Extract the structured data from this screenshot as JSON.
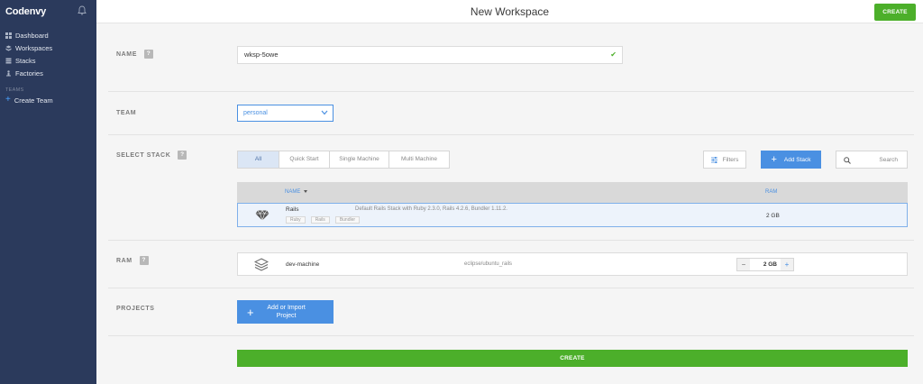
{
  "app": {
    "logo": "Codenvy"
  },
  "sidebar": {
    "items": [
      {
        "label": "Dashboard",
        "icon": "dashboard-icon"
      },
      {
        "label": "Workspaces",
        "icon": "workspaces-icon"
      },
      {
        "label": "Stacks",
        "icon": "stacks-icon"
      },
      {
        "label": "Factories",
        "icon": "factories-icon"
      }
    ],
    "teams_title": "TEAMS",
    "create_team": "Create Team"
  },
  "header": {
    "title": "New Workspace",
    "create_label": "CREATE"
  },
  "name_section": {
    "label": "NAME",
    "help": "?",
    "value": "wksp-5owe",
    "valid_icon": "✔"
  },
  "team_section": {
    "label": "TEAM",
    "selected": "personal"
  },
  "stack_section": {
    "label": "SELECT STACK",
    "help": "?",
    "tabs": [
      "All",
      "Quick Start",
      "Single Machine",
      "Multi Machine"
    ],
    "active_tab": "All",
    "filters_label": "Filters",
    "add_stack_label": "Add Stack",
    "search_placeholder": "Search",
    "table": {
      "columns": [
        "NAME",
        "RAM"
      ],
      "rows": [
        {
          "name": "Rails",
          "description": "Default Rails Stack with Ruby 2.3.0, Rails 4.2.6, Bundler 1.11.2.",
          "tags": [
            "Ruby",
            "Rails",
            "Bundler"
          ],
          "ram": "2 GB",
          "selected": true
        }
      ]
    }
  },
  "ram_section": {
    "label": "RAM",
    "help": "?",
    "machine": {
      "name": "dev-machine",
      "image": "eclipse/ubuntu_rails",
      "ram": "2 GB",
      "minus": "−",
      "plus": "+"
    }
  },
  "projects_section": {
    "label": "PROJECTS",
    "add_label": "Add or Import Project"
  },
  "footer": {
    "create_label": "CREATE"
  },
  "colors": {
    "sidebar": "#2b3a5c",
    "accent": "#4a90e2",
    "success": "#4caf2a"
  }
}
